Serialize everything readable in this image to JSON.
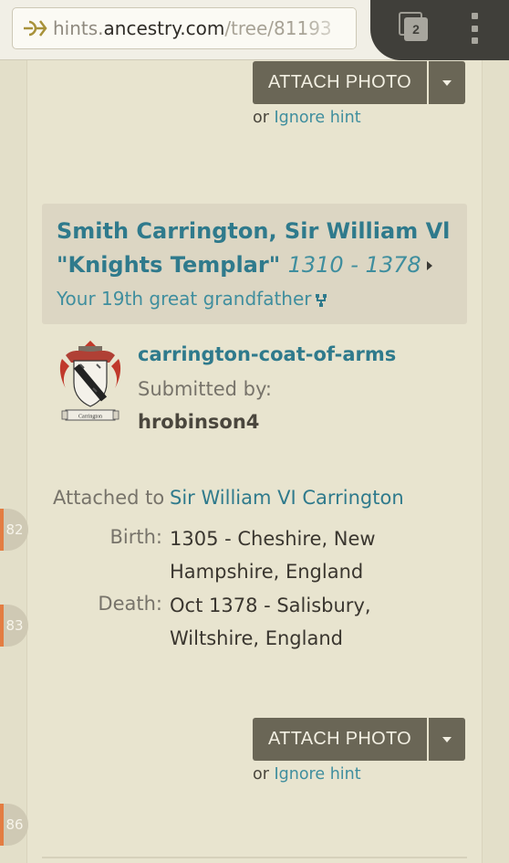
{
  "browser": {
    "url_host": "hints.",
    "url_domain": "ancestry.com",
    "url_path": "/tree/81193",
    "tab_count": "2"
  },
  "top_actions": {
    "attach_label": "ATTACH PHOTO",
    "or_label": "or",
    "ignore_label": "Ignore hint"
  },
  "person": {
    "name_line1": "Smith Carrington, Sir William Vl",
    "name_line2": "\"Knights Templar\"",
    "dates": "1310 - 1378",
    "relation": "Your 19th great grandfather"
  },
  "photo": {
    "title": "carrington-coat-of-arms",
    "submitted_label": "Submitted by:",
    "submitter": "hrobinson4",
    "scroll_text": "Carrington"
  },
  "attached": {
    "label": "Attached to",
    "name": "Sir William VI Carrington",
    "birth_label": "Birth:",
    "birth_value": "1305 - Cheshire, New Hampshire, England",
    "death_label": "Death:",
    "death_value": "Oct 1378 - Salisbury, Wiltshire, England"
  },
  "bottom_actions": {
    "attach_label": "ATTACH PHOTO",
    "or_label": "or",
    "ignore_label": "Ignore hint"
  },
  "line_numbers": [
    "82",
    "83",
    "86"
  ],
  "colors": {
    "link": "#2f7a8c",
    "button": "#6a6656",
    "background": "#e8e4cf",
    "card": "#dcd6c3",
    "marker": "#e37d42"
  }
}
